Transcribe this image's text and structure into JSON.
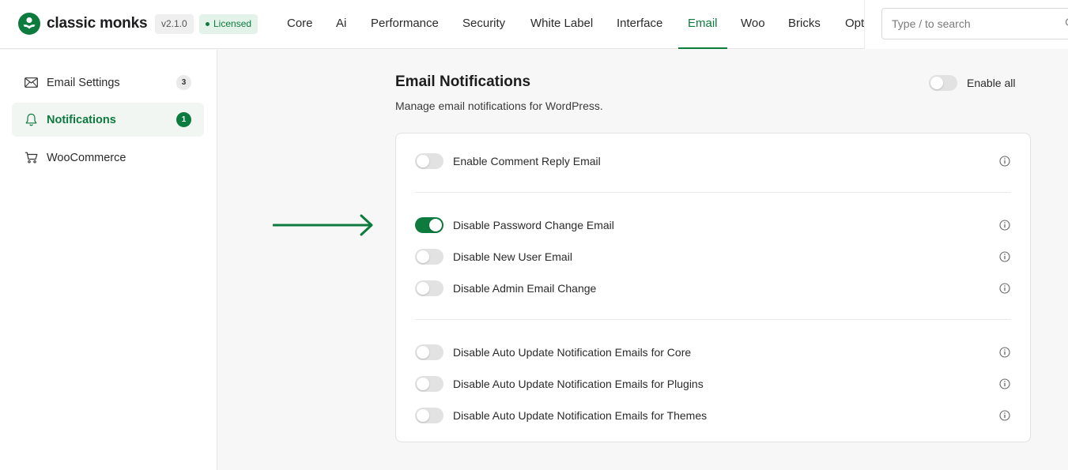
{
  "brand": {
    "name": "classic monks",
    "version": "v2.1.0",
    "license_label": "Licensed",
    "accent_color": "#0d7a3e"
  },
  "nav": {
    "items": [
      {
        "label": "Core"
      },
      {
        "label": "Ai"
      },
      {
        "label": "Performance"
      },
      {
        "label": "Security"
      },
      {
        "label": "White Label"
      },
      {
        "label": "Interface"
      },
      {
        "label": "Email",
        "active": true
      },
      {
        "label": "Woo"
      },
      {
        "label": "Bricks"
      },
      {
        "label": "Opt"
      }
    ]
  },
  "search": {
    "placeholder": "Type / to search",
    "icon": "search-icon"
  },
  "sidebar": {
    "items": [
      {
        "label": "Email Settings",
        "icon": "envelope-icon",
        "badge": "3"
      },
      {
        "label": "Notifications",
        "icon": "bell-icon",
        "badge": "1",
        "active": true
      },
      {
        "label": "WooCommerce",
        "icon": "cart-icon"
      }
    ]
  },
  "main": {
    "title": "Email Notifications",
    "subtitle": "Manage email notifications for WordPress.",
    "enable_all_label": "Enable all",
    "enable_all_on": false,
    "groups": [
      {
        "items": [
          {
            "label": "Enable Comment Reply Email",
            "on": false
          }
        ]
      },
      {
        "items": [
          {
            "label": "Disable Password Change Email",
            "on": true
          },
          {
            "label": "Disable New User Email",
            "on": false
          },
          {
            "label": "Disable Admin Email Change",
            "on": false
          }
        ]
      },
      {
        "items": [
          {
            "label": "Disable Auto Update Notification Emails for Core",
            "on": false
          },
          {
            "label": "Disable Auto Update Notification Emails for Plugins",
            "on": false
          },
          {
            "label": "Disable Auto Update Notification Emails for Themes",
            "on": false
          }
        ]
      }
    ]
  }
}
